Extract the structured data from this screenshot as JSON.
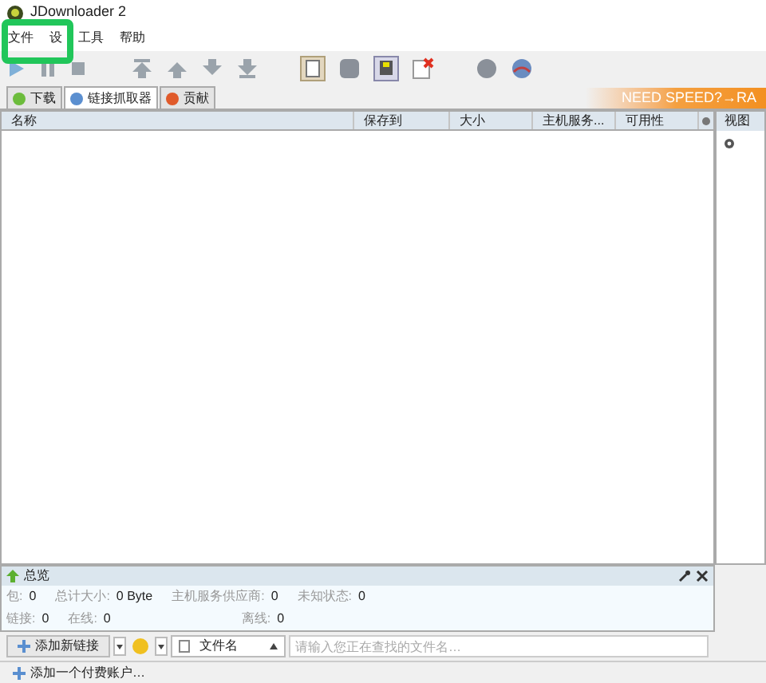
{
  "window": {
    "title": "JDownloader 2"
  },
  "menu": [
    {
      "label": "文件"
    },
    {
      "label": "设"
    },
    {
      "label": "工具"
    },
    {
      "label": "帮助"
    }
  ],
  "tabs": [
    {
      "label": "下载",
      "selected": false
    },
    {
      "label": "链接抓取器",
      "selected": true
    },
    {
      "label": "贡献",
      "selected": false
    }
  ],
  "banner": "NEED SPEED?→RA",
  "table": {
    "columns": [
      "名称",
      "保存到",
      "大小",
      "主机服务...",
      "可用性"
    ]
  },
  "side_panel": {
    "title": "视图"
  },
  "overview": {
    "title": "总览",
    "rows": [
      [
        {
          "label": "包:",
          "value": "0"
        },
        {
          "label": "总计大小:",
          "value": "0 Byte"
        },
        {
          "label": "主机服务供应商:",
          "value": "0"
        },
        {
          "label": "未知状态:",
          "value": "0"
        }
      ],
      [
        {
          "label": "链接:",
          "value": "0"
        },
        {
          "label": "在线:",
          "value": "0"
        },
        {
          "label": "离线:",
          "value": "0"
        }
      ]
    ]
  },
  "bottom_bar": {
    "add_button": "添加新链接",
    "search_scope": "文件名",
    "search": {
      "placeholder": "请输入您正在查找的文件名…"
    }
  },
  "account_link": "添加一个付费账户…"
}
